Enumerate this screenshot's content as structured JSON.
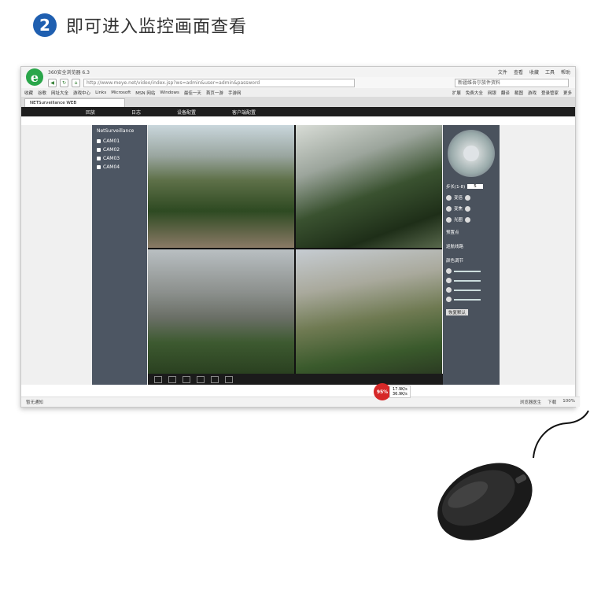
{
  "step": {
    "number": "2",
    "title": "即可进入监控画面查看"
  },
  "browser": {
    "title": "360安全浏览器 6.3",
    "menus": [
      "文件",
      "查看",
      "收藏",
      "工具",
      "帮助"
    ],
    "url": "http://www.meye.net/video/index.jsp?ws=admin&user=admin&password",
    "search_placeholder": "新疆维吾尔族件资料",
    "favorites": [
      "收藏",
      "谷歌",
      "网址大全",
      "游戏中心",
      "Links",
      "Microsoft",
      "MSN 网站",
      "Windows",
      "最佳一天",
      "首页一游",
      "手游网"
    ],
    "favorites_right": [
      "扩展",
      "免费大全",
      "网银",
      "翻译",
      "截图",
      "游戏",
      "登录管家",
      "更多"
    ],
    "tab_label": "NETSurveillance WEB",
    "app_nav": [
      "回放",
      "日志",
      "设备配置",
      "客户端配置"
    ]
  },
  "surveillance": {
    "title": "NetSurveillance",
    "cameras": [
      "CAM01",
      "CAM02",
      "CAM03",
      "CAM04"
    ],
    "ptz": {
      "step_label": "步长(1-8)",
      "step_value": "5",
      "labels": [
        "变倍",
        "变焦",
        "光圈"
      ],
      "preset_label": "预置点",
      "cruise_label": "巡航线路",
      "color_label": "颜色调节",
      "reset_label": "恢复默认"
    }
  },
  "status": {
    "left": "暂无通知",
    "right": [
      "浏览器医生",
      "下载",
      "100%"
    ],
    "net_percent": "95%",
    "up_speed": "17.9K/s",
    "down_speed": "36.9K/s"
  },
  "colors": {
    "accent": "#1f5fb0",
    "browser_green": "#2aa64a",
    "badge_red": "#d62828"
  }
}
